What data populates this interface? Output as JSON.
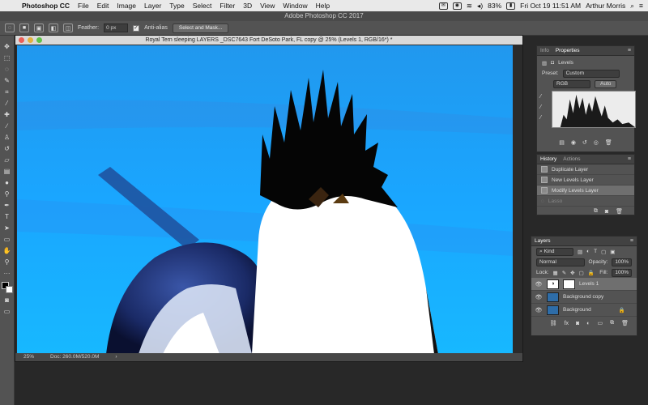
{
  "menubar": {
    "app_name": "Photoshop CC",
    "items": [
      "File",
      "Edit",
      "Image",
      "Layer",
      "Type",
      "Select",
      "Filter",
      "3D",
      "View",
      "Window",
      "Help"
    ],
    "battery": "83%",
    "clock": "Fri Oct 19  11:51 AM",
    "user": "Arthur Morris"
  },
  "app": {
    "title": "Adobe Photoshop CC 2017"
  },
  "options": {
    "feather_label": "Feather:",
    "feather_value": "0 px",
    "antialias_label": "Anti-alias",
    "select_mask_label": "Select and Mask..."
  },
  "document": {
    "title": "Royal Tern sleeping LAYERS _DSC7643  Fort DeSoto Park, FL copy @ 25% (Levels 1, RGB/16*) *",
    "zoom": "25%",
    "doc_size": "Doc: 260.0M/520.0M",
    "nav_arrow": "›"
  },
  "properties": {
    "tabs": [
      "Info",
      "Properties"
    ],
    "panel_title": "Levels",
    "preset_label": "Preset:",
    "preset_value": "Custom",
    "channel_value": "RGB",
    "auto_label": "Auto"
  },
  "history": {
    "tabs": [
      "History",
      "Actions"
    ],
    "items": [
      {
        "label": "Duplicate Layer",
        "state": "normal"
      },
      {
        "label": "New Levels Layer",
        "state": "normal"
      },
      {
        "label": "Modify Levels Layer",
        "state": "selected"
      },
      {
        "label": "Lasso",
        "state": "dim"
      }
    ]
  },
  "layers": {
    "tab": "Layers",
    "kind_label": "Kind",
    "blend_mode": "Normal",
    "opacity_label": "Opacity:",
    "opacity_value": "100%",
    "lock_label": "Lock:",
    "fill_label": "Fill:",
    "fill_value": "100%",
    "items": [
      {
        "name": "Levels 1",
        "type": "adjustment",
        "selected": true
      },
      {
        "name": "Background copy",
        "type": "pixel",
        "selected": false
      },
      {
        "name": "Background",
        "type": "pixel",
        "locked": true,
        "selected": false
      }
    ]
  },
  "colors": {
    "sky": "#1aa6ff",
    "panel_bg": "#535353"
  }
}
